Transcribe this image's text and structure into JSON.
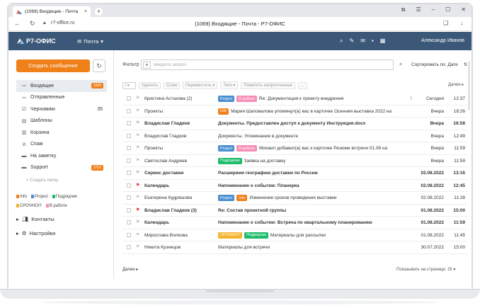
{
  "browser": {
    "tab_title": "(1069) Входящие - Почта",
    "tab_close": "×",
    "new_tab": "+",
    "url": "r7-office.ru",
    "page_title": "(1069) Входящие - Почта - Р7-ОФИС"
  },
  "header": {
    "brand": "Р7-ОФИС",
    "module": "Почта",
    "user": "Александр Иванов"
  },
  "sidebar": {
    "compose": "Создать сообщение",
    "folders": [
      {
        "label": "Входящие",
        "icon": "inbox-icon",
        "badge": "1069",
        "active": true
      },
      {
        "label": "Отправленные",
        "icon": "sent-icon"
      },
      {
        "label": "Черновики",
        "icon": "drafts-icon",
        "count": "35"
      },
      {
        "label": "Шаблоны",
        "icon": "templates-icon"
      },
      {
        "label": "Корзина",
        "icon": "trash-icon"
      },
      {
        "label": "Спам",
        "icon": "spam-icon"
      },
      {
        "label": "На заметку",
        "icon": "folder-icon"
      },
      {
        "label": "Support",
        "icon": "folder-icon",
        "badge": "3716"
      }
    ],
    "create_folder": "+ Создать папку",
    "tags": [
      {
        "label": "Info",
        "color": "#f0801a"
      },
      {
        "label": "Project",
        "color": "#4a8fd1"
      },
      {
        "label": "Подрядчик",
        "color": "#1ebc6a"
      },
      {
        "label": "СРОЧНО!!!",
        "color": "#f5b430"
      },
      {
        "label": "В работе",
        "color": "#f58fb5"
      }
    ],
    "contacts": "Контакты",
    "settings": "Настройки"
  },
  "filter": {
    "label": "Фильтр",
    "placeholder": "введите запрос",
    "sort": "Сортировать по: Дате"
  },
  "toolbar": {
    "delete": "Удалить",
    "spam": "Спам",
    "move": "Переместить",
    "tags": "Теги",
    "mark_unread": "Пометить непрочтенные",
    "more": "...",
    "next": "Далее"
  },
  "mails": [
    {
      "from": "Кристина Астахова (2)",
      "tags": [
        {
          "t": "Project",
          "c": "#4a8fd1"
        },
        {
          "t": "В работе",
          "c": "#f58fb5"
        }
      ],
      "subject": "Re: Документация к проекту внедрения",
      "attach": true,
      "date": "Сегодня",
      "time": "12:37",
      "unread": false,
      "flag": false
    },
    {
      "from": "Проекты",
      "tags": [
        {
          "t": "Info",
          "c": "#f0801a"
        }
      ],
      "subject": "Мария Шаповалова упомянул(а) вас в карточке Осенняя выставка 2022 на",
      "date": "Вчера",
      "time": "18:26",
      "unread": false,
      "flag": false
    },
    {
      "from": "Владислав Гладков",
      "tags": [],
      "subject": "Документы. Предоставлен доступ к документу Инструкция.docx",
      "date": "Вчера",
      "time": "16:58",
      "unread": true,
      "flag": false
    },
    {
      "from": "Владислав Гладков",
      "tags": [],
      "subject": "Документы. Упоминание в документе",
      "date": "Вчера",
      "time": "12:49",
      "unread": false,
      "flag": false
    },
    {
      "from": "Проекты",
      "tags": [
        {
          "t": "Project",
          "c": "#4a8fd1"
        },
        {
          "t": "В работе",
          "c": "#f58fb5"
        }
      ],
      "subject": "Михаил добавил(а) вас к карточке Резюме встречи 01.08 на",
      "date": "Вчера",
      "time": "11:59",
      "unread": false,
      "flag": false
    },
    {
      "from": "Святослав Андреев",
      "tags": [
        {
          "t": "Подрядчик",
          "c": "#1ebc6a"
        }
      ],
      "subject": "Заявка на доставку",
      "date": "Вчера",
      "time": "11:59",
      "unread": false,
      "flag": false
    },
    {
      "from": "Сервис доставки",
      "tags": [],
      "subject": "Расширяем географию доставки по России",
      "date": "02.08.2022",
      "time": "13:16",
      "unread": true,
      "flag": false
    },
    {
      "from": "Календарь",
      "tags": [],
      "subject": "Напоминание о событии: Планерка",
      "date": "02.08.2022",
      "time": "12:45",
      "unread": true,
      "flag": true
    },
    {
      "from": "Екатерина Кудряшова",
      "tags": [
        {
          "t": "Project",
          "c": "#4a8fd1"
        },
        {
          "t": "Info",
          "c": "#f0801a"
        }
      ],
      "subject": "Изменение сроков проведения выставки",
      "date": "02.08.2022",
      "time": "11:28",
      "unread": false,
      "flag": false
    },
    {
      "from": "Владислав Гладков (3)",
      "tags": [],
      "subject": "Re: Состав проектной группы",
      "date": "01.08.2022",
      "time": "15:00",
      "unread": true,
      "flag": true
    },
    {
      "from": "Календарь",
      "tags": [],
      "subject": "Напоминание о событии: Встреча по квартальному планированию",
      "date": "01.08.2022",
      "time": "11:59",
      "unread": true,
      "flag": false
    },
    {
      "from": "Мирослава Волкова",
      "tags": [
        {
          "t": "СРОЧНО!!!",
          "c": "#f5b430"
        },
        {
          "t": "Подрядчик",
          "c": "#1ebc6a"
        }
      ],
      "subject": "Материалы для рассылки",
      "date": "01.08.2022",
      "time": "11:45",
      "unread": false,
      "flag": false
    },
    {
      "from": "Никита Кузнецов",
      "tags": [],
      "subject": "Материалы для встречи",
      "date": "30.07.2022",
      "time": "15:00",
      "unread": false,
      "flag": false
    }
  ],
  "footer": {
    "more": "Далее",
    "per_page": "Показывать на странице:",
    "per_page_value": "25"
  }
}
